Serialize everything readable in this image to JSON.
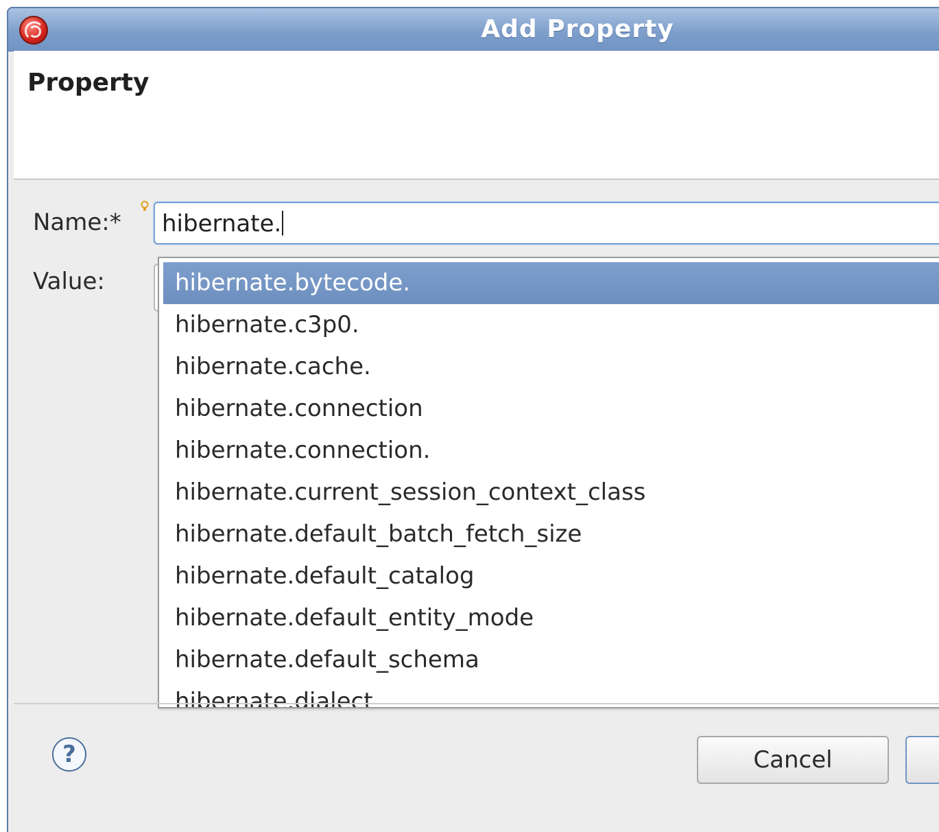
{
  "window": {
    "title": "Add Property",
    "app_icon": "redhat-app-icon"
  },
  "header": {
    "title": "Property"
  },
  "form": {
    "name_label": "Name:*",
    "name_value": "hibernate.",
    "hint_icon": "content-assist-lightbulb-icon",
    "value_label": "Value:"
  },
  "autocomplete": {
    "selected_index": 0,
    "items": [
      "hibernate.bytecode.",
      "hibernate.c3p0.",
      "hibernate.cache.",
      "hibernate.connection",
      "hibernate.connection.",
      "hibernate.current_session_context_class",
      "hibernate.default_batch_fetch_size",
      "hibernate.default_catalog",
      "hibernate.default_entity_mode",
      "hibernate.default_schema",
      "hibernate.dialect"
    ]
  },
  "footer": {
    "help_icon": "help-question-icon",
    "help_glyph": "?",
    "cancel_label": "Cancel",
    "ok_label": ""
  },
  "colors": {
    "titlebar": "#7f9fcb",
    "selection": "#7094c4",
    "background": "#ededed"
  }
}
